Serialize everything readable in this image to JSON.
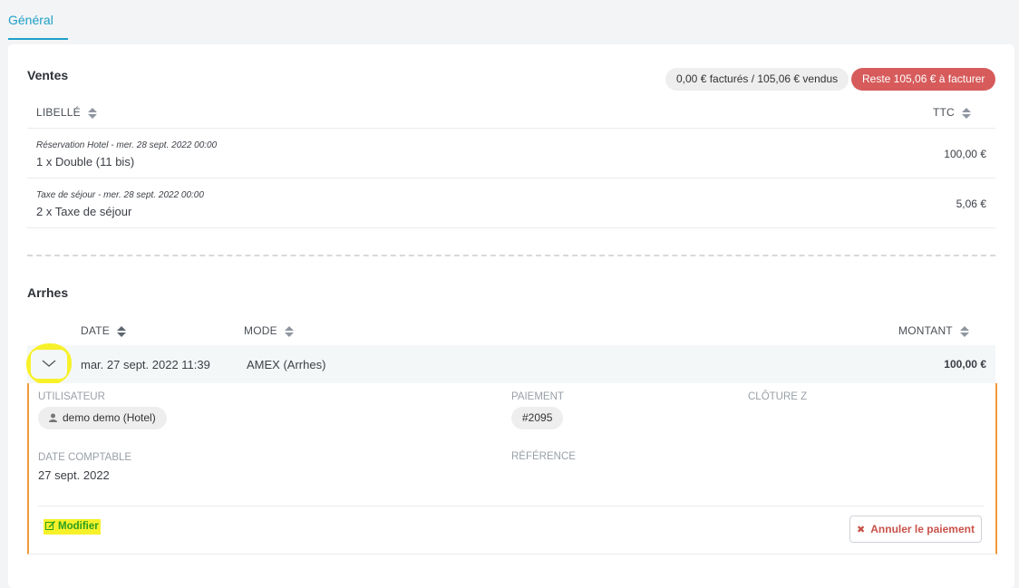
{
  "tabs": {
    "general": "Général"
  },
  "ventes": {
    "title": "Ventes",
    "summary_billed": "0,00 € facturés / 105,06 € vendus",
    "summary_remaining": "Reste 105,06 € à facturer",
    "columns": {
      "label": "LIBELLÉ",
      "ttc": "TTC"
    },
    "rows": [
      {
        "sub": "Réservation Hotel - mer. 28 sept. 2022 00:00",
        "main": "1 x Double (11 bis)",
        "amount": "100,00 €"
      },
      {
        "sub": "Taxe de séjour - mer. 28 sept. 2022 00:00",
        "main": "2 x Taxe de séjour",
        "amount": "5,06 €"
      }
    ]
  },
  "arrhes": {
    "title": "Arrhes",
    "columns": {
      "date": "DATE",
      "mode": "MODE",
      "amount": "MONTANT"
    },
    "payment": {
      "date": "mar. 27 sept. 2022 11:39",
      "mode": "AMEX (Arrhes)",
      "amount": "100,00 €"
    },
    "detail": {
      "user_label": "UTILISATEUR",
      "user_value": "demo demo (Hotel)",
      "payment_label": "PAIEMENT",
      "payment_value": "#2095",
      "closure_label": "CLÔTURE Z",
      "accounting_date_label": "DATE COMPTABLE",
      "accounting_date_value": "27 sept. 2022",
      "reference_label": "RÉFÉRENCE",
      "modify_label": "Modifier",
      "cancel_label": "Annuler le paiement"
    }
  },
  "colors": {
    "accent": "#1ea0c6",
    "danger": "#d75b5b",
    "highlight": "#f7f12a",
    "detail_border": "#f39a3b"
  }
}
